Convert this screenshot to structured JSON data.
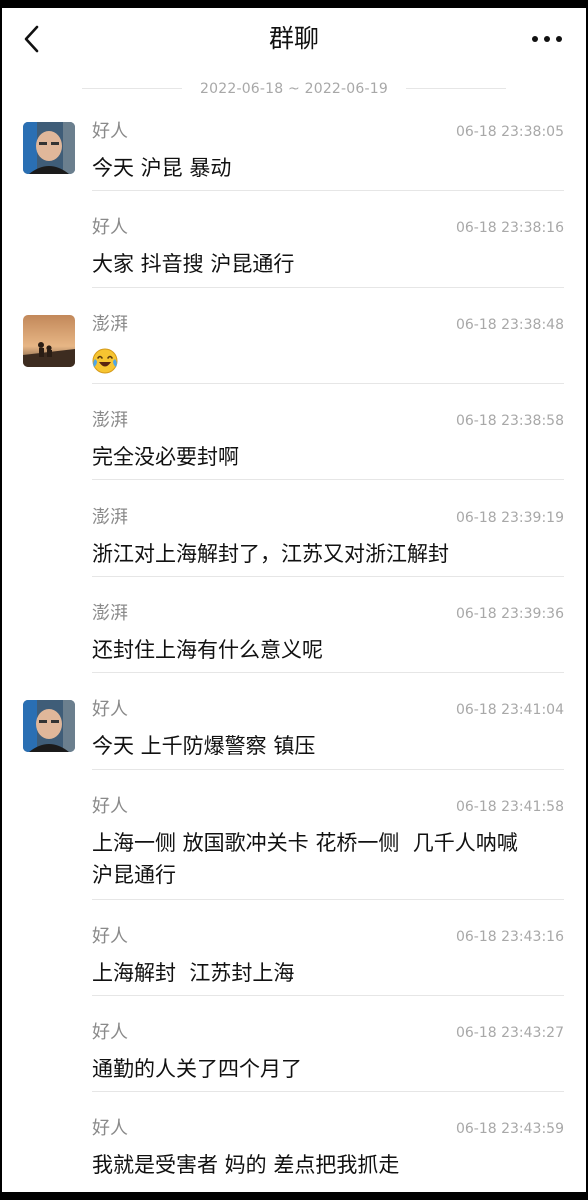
{
  "header": {
    "title": "群聊",
    "back_icon": "chevron-left-icon",
    "more_icon": "more-dots-icon"
  },
  "date_range": "2022-06-18 ~ 2022-06-19",
  "messages": [
    {
      "sender": "好人",
      "time": "06-18 23:38:05",
      "text": "今天 沪昆 暴动"
    },
    {
      "sender": "好人",
      "time": "06-18 23:38:16",
      "text": "大家 抖音搜 沪昆通行"
    },
    {
      "sender": "澎湃",
      "time": "06-18 23:38:48",
      "text": "",
      "emoji": "laughing-crying-emoji"
    },
    {
      "sender": "澎湃",
      "time": "06-18 23:38:58",
      "text": "完全没必要封啊"
    },
    {
      "sender": "澎湃",
      "time": "06-18 23:39:19",
      "text": "浙江对上海解封了，江苏又对浙江解封"
    },
    {
      "sender": "澎湃",
      "time": "06-18 23:39:36",
      "text": "还封住上海有什么意义呢"
    },
    {
      "sender": "好人",
      "time": "06-18 23:41:04",
      "text": "今天 上千防爆警察 镇压"
    },
    {
      "sender": "好人",
      "time": "06-18 23:41:58",
      "text": "上海一侧 放国歌冲关卡 花桥一侧  几千人呐喊\n沪昆通行"
    },
    {
      "sender": "好人",
      "time": "06-18 23:43:16",
      "text": "上海解封  江苏封上海"
    },
    {
      "sender": "好人",
      "time": "06-18 23:43:27",
      "text": "通勤的人关了四个月了"
    },
    {
      "sender": "好人",
      "time": "06-18 23:43:59",
      "text": "我就是受害者 妈的 差点把我抓走"
    }
  ],
  "colors": {
    "background": "#ffffff",
    "text": "#111111",
    "secondary": "#8a8a8a",
    "divider": "#e6e6e6"
  }
}
